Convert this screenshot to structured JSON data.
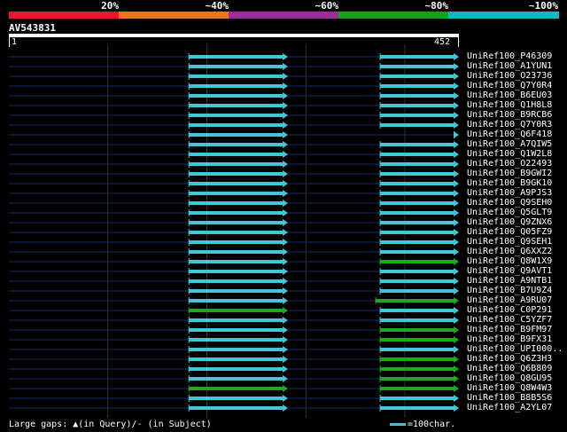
{
  "legend": {
    "segments": [
      {
        "color": "#e8162e"
      },
      {
        "color": "#e8761e"
      },
      {
        "color": "#9a2e9a"
      },
      {
        "color": "#18a018"
      },
      {
        "color": "#12b8c0"
      }
    ],
    "labels": [
      "20%",
      "~40%",
      "~60%",
      "~80%",
      "~100%"
    ]
  },
  "query": {
    "name": "AV543831",
    "start": "1",
    "end": "452"
  },
  "hits": [
    {
      "label": "UniRef100_P46309",
      "segments": [
        {
          "from": 0.4,
          "to": 0.62,
          "color": "#40c8d8"
        },
        {
          "from": 0.825,
          "to": 1.0,
          "color": "#40c8d8"
        }
      ]
    },
    {
      "label": "UniRef100_A1YUN1",
      "segments": [
        {
          "from": 0.4,
          "to": 0.62,
          "color": "#40c8d8"
        },
        {
          "from": 0.825,
          "to": 1.0,
          "color": "#40c8d8"
        }
      ]
    },
    {
      "label": "UniRef100_O23736",
      "segments": [
        {
          "from": 0.4,
          "to": 0.62,
          "color": "#40c8d8"
        },
        {
          "from": 0.825,
          "to": 1.0,
          "color": "#40c8d8"
        }
      ]
    },
    {
      "label": "UniRef100_Q7Y0R4",
      "segments": [
        {
          "from": 0.4,
          "to": 0.62,
          "color": "#40c8d8"
        },
        {
          "from": 0.825,
          "to": 1.0,
          "color": "#40c8d8"
        }
      ]
    },
    {
      "label": "UniRef100_B6EU03",
      "segments": [
        {
          "from": 0.4,
          "to": 0.62,
          "color": "#40c8d8"
        },
        {
          "from": 0.825,
          "to": 1.0,
          "color": "#40c8d8"
        }
      ]
    },
    {
      "label": "UniRef100_Q1H8L8",
      "segments": [
        {
          "from": 0.4,
          "to": 0.62,
          "color": "#40c8d8"
        },
        {
          "from": 0.825,
          "to": 1.0,
          "color": "#40c8d8"
        }
      ]
    },
    {
      "label": "UniRef100_B9RCB6",
      "segments": [
        {
          "from": 0.4,
          "to": 0.62,
          "color": "#40c8d8"
        },
        {
          "from": 0.825,
          "to": 1.0,
          "color": "#40c8d8"
        }
      ]
    },
    {
      "label": "UniRef100_Q7Y0R3",
      "segments": [
        {
          "from": 0.4,
          "to": 0.62,
          "color": "#40c8d8"
        },
        {
          "from": 0.825,
          "to": 1.0,
          "color": "#40c8d8"
        }
      ]
    },
    {
      "label": "UniRef100_Q6F418",
      "segments": [
        {
          "from": 0.4,
          "to": 0.62,
          "color": "#40c8d8"
        },
        {
          "from": 0.99,
          "to": 1.0,
          "color": "#40c8d8"
        }
      ]
    },
    {
      "label": "UniRef100_A7QIW5",
      "segments": [
        {
          "from": 0.4,
          "to": 0.62,
          "color": "#40c8d8"
        },
        {
          "from": 0.825,
          "to": 1.0,
          "color": "#40c8d8"
        }
      ]
    },
    {
      "label": "UniRef100_Q1W2L8",
      "segments": [
        {
          "from": 0.4,
          "to": 0.62,
          "color": "#40c8d8"
        },
        {
          "from": 0.825,
          "to": 1.0,
          "color": "#40c8d8"
        }
      ]
    },
    {
      "label": "UniRef100_O22493",
      "segments": [
        {
          "from": 0.4,
          "to": 0.62,
          "color": "#40c8d8"
        },
        {
          "from": 0.825,
          "to": 1.0,
          "color": "#40c8d8"
        }
      ]
    },
    {
      "label": "UniRef100_B9GWI2",
      "segments": [
        {
          "from": 0.4,
          "to": 0.62,
          "color": "#40c8d8"
        },
        {
          "from": 0.825,
          "to": 1.0,
          "color": "#40c8d8"
        }
      ]
    },
    {
      "label": "UniRef100_B9GK10",
      "segments": [
        {
          "from": 0.4,
          "to": 0.62,
          "color": "#40c8d8"
        },
        {
          "from": 0.825,
          "to": 1.0,
          "color": "#40c8d8"
        }
      ]
    },
    {
      "label": "UniRef100_A9PJS3",
      "segments": [
        {
          "from": 0.4,
          "to": 0.62,
          "color": "#40c8d8"
        },
        {
          "from": 0.825,
          "to": 1.0,
          "color": "#40c8d8"
        }
      ]
    },
    {
      "label": "UniRef100_Q9SEH0",
      "segments": [
        {
          "from": 0.4,
          "to": 0.62,
          "color": "#40c8d8"
        },
        {
          "from": 0.825,
          "to": 1.0,
          "color": "#40c8d8"
        }
      ]
    },
    {
      "label": "UniRef100_Q5GLT9",
      "segments": [
        {
          "from": 0.4,
          "to": 0.62,
          "color": "#40c8d8"
        },
        {
          "from": 0.825,
          "to": 1.0,
          "color": "#40c8d8"
        }
      ]
    },
    {
      "label": "UniRef100_Q9ZNX6",
      "segments": [
        {
          "from": 0.4,
          "to": 0.62,
          "color": "#40c8d8"
        },
        {
          "from": 0.825,
          "to": 1.0,
          "color": "#40c8d8"
        }
      ]
    },
    {
      "label": "UniRef100_Q05FZ9",
      "segments": [
        {
          "from": 0.4,
          "to": 0.62,
          "color": "#40c8d8"
        },
        {
          "from": 0.825,
          "to": 1.0,
          "color": "#40c8d8"
        }
      ]
    },
    {
      "label": "UniRef100_Q9SEH1",
      "segments": [
        {
          "from": 0.4,
          "to": 0.62,
          "color": "#40c8d8"
        },
        {
          "from": 0.825,
          "to": 1.0,
          "color": "#40c8d8"
        }
      ]
    },
    {
      "label": "UniRef100_Q6XXZ2",
      "segments": [
        {
          "from": 0.4,
          "to": 0.62,
          "color": "#40c8d8"
        },
        {
          "from": 0.825,
          "to": 1.0,
          "color": "#40c8d8"
        }
      ]
    },
    {
      "label": "UniRef100_Q8W1X9",
      "segments": [
        {
          "from": 0.4,
          "to": 0.62,
          "color": "#40c8d8"
        },
        {
          "from": 0.825,
          "to": 1.0,
          "color": "#1ea81e"
        }
      ]
    },
    {
      "label": "UniRef100_Q9AVT1",
      "segments": [
        {
          "from": 0.4,
          "to": 0.62,
          "color": "#40c8d8"
        },
        {
          "from": 0.825,
          "to": 1.0,
          "color": "#40c8d8"
        }
      ]
    },
    {
      "label": "UniRef100_A9NTB1",
      "segments": [
        {
          "from": 0.4,
          "to": 0.62,
          "color": "#40c8d8"
        },
        {
          "from": 0.825,
          "to": 1.0,
          "color": "#40c8d8"
        }
      ]
    },
    {
      "label": "UniRef100_B7U9Z4",
      "segments": [
        {
          "from": 0.4,
          "to": 0.62,
          "color": "#40c8d8"
        },
        {
          "from": 0.825,
          "to": 1.0,
          "color": "#40c8d8"
        }
      ]
    },
    {
      "label": "UniRef100_A9RU07",
      "segments": [
        {
          "from": 0.4,
          "to": 0.62,
          "color": "#40c8d8"
        },
        {
          "from": 0.815,
          "to": 1.0,
          "color": "#1ea81e"
        }
      ]
    },
    {
      "label": "UniRef100_C0P291",
      "segments": [
        {
          "from": 0.4,
          "to": 0.62,
          "color": "#1ea81e"
        },
        {
          "from": 0.825,
          "to": 1.0,
          "color": "#40c8d8"
        }
      ]
    },
    {
      "label": "UniRef100_C5YZF7",
      "segments": [
        {
          "from": 0.4,
          "to": 0.62,
          "color": "#40c8d8"
        },
        {
          "from": 0.825,
          "to": 1.0,
          "color": "#40c8d8"
        }
      ]
    },
    {
      "label": "UniRef100_B9FM97",
      "segments": [
        {
          "from": 0.4,
          "to": 0.62,
          "color": "#40c8d8"
        },
        {
          "from": 0.825,
          "to": 1.0,
          "color": "#1ea81e"
        }
      ]
    },
    {
      "label": "UniRef100_B9FX31",
      "segments": [
        {
          "from": 0.4,
          "to": 0.62,
          "color": "#40c8d8"
        },
        {
          "from": 0.825,
          "to": 1.0,
          "color": "#1ea81e"
        }
      ]
    },
    {
      "label": "UniRef100_UPI000..",
      "segments": [
        {
          "from": 0.4,
          "to": 0.62,
          "color": "#40c8d8"
        },
        {
          "from": 0.825,
          "to": 1.0,
          "color": "#40c8d8"
        }
      ]
    },
    {
      "label": "UniRef100_Q6Z3H3",
      "segments": [
        {
          "from": 0.4,
          "to": 0.62,
          "color": "#40c8d8"
        },
        {
          "from": 0.825,
          "to": 1.0,
          "color": "#1ea81e"
        }
      ]
    },
    {
      "label": "UniRef100_Q6B809",
      "segments": [
        {
          "from": 0.4,
          "to": 0.62,
          "color": "#40c8d8"
        },
        {
          "from": 0.825,
          "to": 1.0,
          "color": "#1ea81e"
        }
      ]
    },
    {
      "label": "UniRef100_Q8GU95",
      "segments": [
        {
          "from": 0.4,
          "to": 0.62,
          "color": "#40c8d8"
        },
        {
          "from": 0.825,
          "to": 1.0,
          "color": "#1ea81e"
        }
      ]
    },
    {
      "label": "UniRef100_Q8W4W3",
      "segments": [
        {
          "from": 0.4,
          "to": 0.62,
          "color": "#1ea81e"
        },
        {
          "from": 0.825,
          "to": 1.0,
          "color": "#1ea81e"
        }
      ]
    },
    {
      "label": "UniRef100_B8B5S6",
      "segments": [
        {
          "from": 0.4,
          "to": 0.62,
          "color": "#40c8d8"
        },
        {
          "from": 0.825,
          "to": 1.0,
          "color": "#40c8d8"
        }
      ]
    },
    {
      "label": "UniRef100_A2YL07",
      "segments": [
        {
          "from": 0.4,
          "to": 0.62,
          "color": "#40c8d8"
        },
        {
          "from": 0.825,
          "to": 1.0,
          "color": "#40c8d8"
        }
      ]
    }
  ],
  "footer": {
    "gaps_text": "Large gaps: ▲(in Query)/- (in Subject)",
    "scale_text": "=100char."
  },
  "colors": {
    "background": "#000000",
    "line": "#1a2a6a",
    "grid": "#2a3a2a",
    "cyan": "#40c8d8",
    "green": "#1ea81e"
  }
}
